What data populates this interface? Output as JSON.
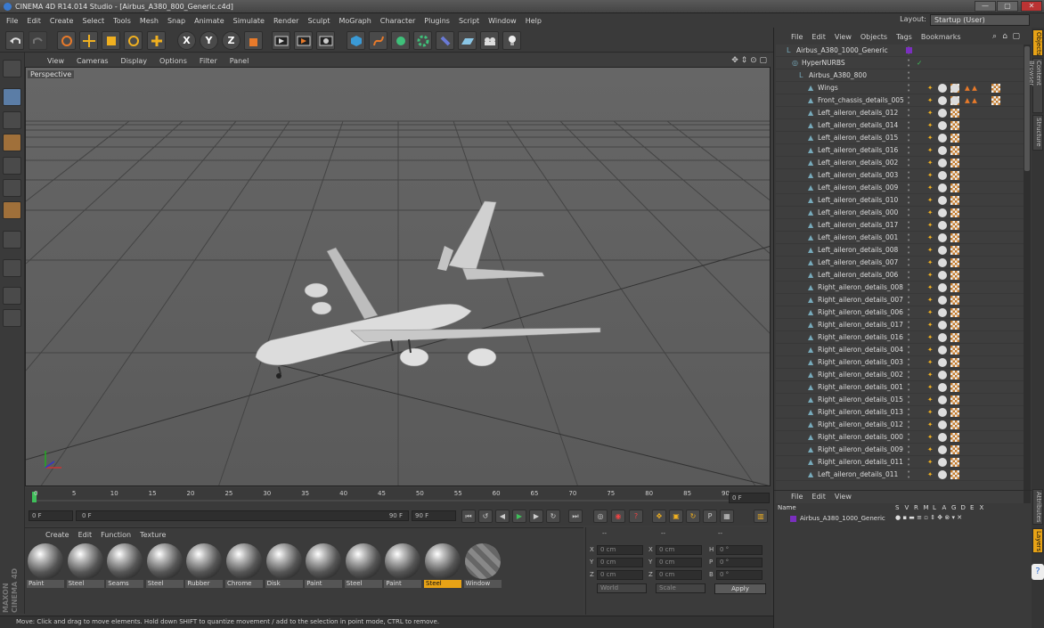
{
  "window": {
    "title": "CINEMA 4D R14.014 Studio - [Airbus_A380_800_Generic.c4d]",
    "minimize": "—",
    "maximize": "▢",
    "close": "✕"
  },
  "menubar": {
    "items": [
      "File",
      "Edit",
      "Create",
      "Select",
      "Tools",
      "Mesh",
      "Snap",
      "Animate",
      "Simulate",
      "Render",
      "Sculpt",
      "MoGraph",
      "Character",
      "Plugins",
      "Script",
      "Window",
      "Help"
    ],
    "layout_label": "Layout:",
    "layout_value": "Startup (User)"
  },
  "toolbar": {
    "axis_x": "X",
    "axis_y": "Y",
    "axis_z": "Z"
  },
  "viewport": {
    "menu": [
      "View",
      "Cameras",
      "Display",
      "Options",
      "Filter",
      "Panel"
    ],
    "label": "Perspective"
  },
  "timeline": {
    "ticks": [
      "0",
      "5",
      "10",
      "15",
      "20",
      "25",
      "30",
      "35",
      "40",
      "45",
      "50",
      "55",
      "60",
      "65",
      "70",
      "75",
      "80",
      "85",
      "90"
    ],
    "current_frame": "0 F"
  },
  "transport": {
    "start": "0 F",
    "range_start": "0 F",
    "range_end": "90 F",
    "end": "90 F"
  },
  "materials": {
    "menu": [
      "Create",
      "Edit",
      "Function",
      "Texture"
    ],
    "items": [
      {
        "name": "Paint"
      },
      {
        "name": "Steel"
      },
      {
        "name": "Seams"
      },
      {
        "name": "Steel"
      },
      {
        "name": "Rubber"
      },
      {
        "name": "Chrome"
      },
      {
        "name": "Disk"
      },
      {
        "name": "Paint"
      },
      {
        "name": "Steel"
      },
      {
        "name": "Paint"
      },
      {
        "name": "Steel"
      },
      {
        "name": "Window"
      }
    ],
    "selected_index": 10
  },
  "coordinates": {
    "header_left": "--",
    "header_mid": "--",
    "header_right": "--",
    "pos_labels": [
      "X",
      "Y",
      "Z"
    ],
    "size_labels": [
      "X",
      "Y",
      "Z"
    ],
    "rot_labels": [
      "H",
      "P",
      "B"
    ],
    "pos": [
      "0 cm",
      "0 cm",
      "0 cm"
    ],
    "size": [
      "0 cm",
      "0 cm",
      "0 cm"
    ],
    "rot": [
      "0 °",
      "0 °",
      "0 °"
    ],
    "mode": "World",
    "scale": "Scale",
    "apply": "Apply"
  },
  "object_manager": {
    "menu": [
      "File",
      "Edit",
      "View",
      "Objects",
      "Tags",
      "Bookmarks"
    ],
    "objects": [
      {
        "name": "Airbus_A380_1000_Generic",
        "level": 0
      },
      {
        "name": "HyperNURBS",
        "level": 1
      },
      {
        "name": "Airbus_A380_800",
        "level": 2
      },
      {
        "name": "Wings",
        "level": 3
      },
      {
        "name": "Front_chassis_details_005",
        "level": 3
      },
      {
        "name": "Left_aileron_details_012",
        "level": 3
      },
      {
        "name": "Left_aileron_details_014",
        "level": 3
      },
      {
        "name": "Left_aileron_details_015",
        "level": 3
      },
      {
        "name": "Left_aileron_details_016",
        "level": 3
      },
      {
        "name": "Left_aileron_details_002",
        "level": 3
      },
      {
        "name": "Left_aileron_details_003",
        "level": 3
      },
      {
        "name": "Left_aileron_details_009",
        "level": 3
      },
      {
        "name": "Left_aileron_details_010",
        "level": 3
      },
      {
        "name": "Left_aileron_details_000",
        "level": 3
      },
      {
        "name": "Left_aileron_details_017",
        "level": 3
      },
      {
        "name": "Left_aileron_details_001",
        "level": 3
      },
      {
        "name": "Left_aileron_details_008",
        "level": 3
      },
      {
        "name": "Left_aileron_details_007",
        "level": 3
      },
      {
        "name": "Left_aileron_details_006",
        "level": 3
      },
      {
        "name": "Right_aileron_details_008",
        "level": 3
      },
      {
        "name": "Right_aileron_details_007",
        "level": 3
      },
      {
        "name": "Right_aileron_details_006",
        "level": 3
      },
      {
        "name": "Right_aileron_details_017",
        "level": 3
      },
      {
        "name": "Right_aileron_details_016",
        "level": 3
      },
      {
        "name": "Right_aileron_details_004",
        "level": 3
      },
      {
        "name": "Right_aileron_details_003",
        "level": 3
      },
      {
        "name": "Right_aileron_details_002",
        "level": 3
      },
      {
        "name": "Right_aileron_details_001",
        "level": 3
      },
      {
        "name": "Right_aileron_details_015",
        "level": 3
      },
      {
        "name": "Right_aileron_details_013",
        "level": 3
      },
      {
        "name": "Right_aileron_details_012",
        "level": 3
      },
      {
        "name": "Right_aileron_details_000",
        "level": 3
      },
      {
        "name": "Right_aileron_details_009",
        "level": 3
      },
      {
        "name": "Right_aileron_details_011",
        "level": 3
      },
      {
        "name": "Left_aileron_details_011",
        "level": 3
      }
    ]
  },
  "layer_manager": {
    "menu": [
      "File",
      "Edit",
      "View"
    ],
    "columns": [
      "Name",
      "S",
      "V",
      "R",
      "M",
      "L",
      "A",
      "G",
      "D",
      "E",
      "X"
    ],
    "layer": "Airbus_A380_1000_Generic"
  },
  "side_tabs": [
    "Objects",
    "Content Browser",
    "Structure",
    "Attributes",
    "Layers"
  ],
  "status": "Move: Click and drag to move elements. Hold down SHIFT to quantize movement / add to the selection in point mode, CTRL to remove.",
  "brand": {
    "line1": "MAXON",
    "line2": "CINEMA 4D"
  },
  "colors": {
    "accent": "#e8a316",
    "layer_color": "#7a2fbf"
  }
}
